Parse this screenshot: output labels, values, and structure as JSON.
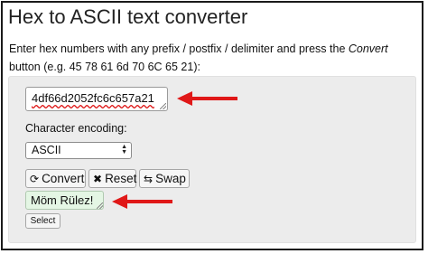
{
  "page": {
    "title": "Hex to ASCII text converter",
    "instructions_before": "Enter hex numbers with any prefix / postfix / delimiter and press the ",
    "instructions_em": "Convert",
    "instructions_after": " button (e.g. 45 78 61 6d 70 6C 65 21):"
  },
  "converter": {
    "hex_value": "4df66d2052fc6c657a21",
    "encoding_label": "Character encoding:",
    "encoding_selected": "ASCII",
    "convert_label": "Convert",
    "reset_label": "Reset",
    "swap_label": "Swap",
    "output_value": "Möm Rülez!",
    "select_label": "Select"
  },
  "annotations": {
    "arrow_color": "#e01818"
  },
  "icons": {
    "convert": "refresh-icon",
    "reset": "close-x-icon",
    "swap": "swap-arrows-icon"
  }
}
